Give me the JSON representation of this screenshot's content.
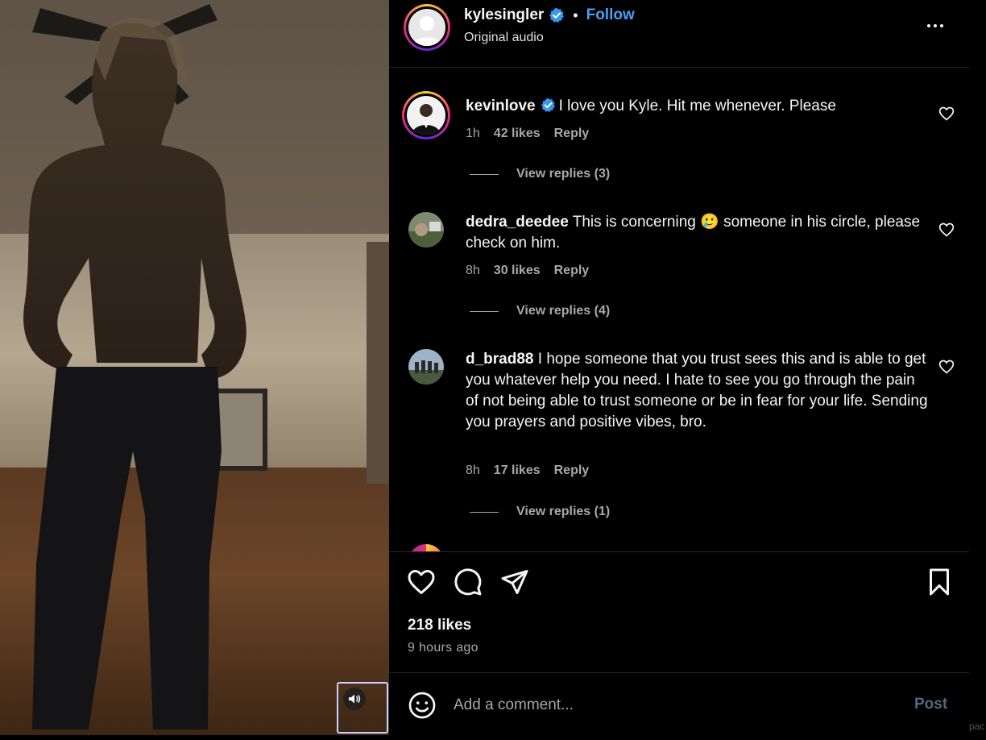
{
  "post": {
    "username": "kylesingler",
    "separator": "•",
    "follow_label": "Follow",
    "subtitle": "Original audio",
    "more_icon": "more-horizontal-icon"
  },
  "comments": [
    {
      "username": "kevinlove",
      "verified": true,
      "text": "I love you Kyle. Hit me whenever. Please",
      "time": "1h",
      "likes": "42 likes",
      "reply_label": "Reply",
      "view_replies": "View replies (3)"
    },
    {
      "username": "dedra_deedee",
      "verified": false,
      "text": "This is concerning 🥲 someone in his circle, please check on him.",
      "time": "8h",
      "likes": "30 likes",
      "reply_label": "Reply",
      "view_replies": "View replies (4)"
    },
    {
      "username": "d_brad88",
      "verified": false,
      "text": "I hope someone that you trust sees this and is able to get you whatever help you need. I hate to see you go through the pain of not being able to trust someone or be in fear for your life. Sending you prayers and positive vibes, bro.",
      "time": "8h",
      "likes": "17 likes",
      "reply_label": "Reply",
      "view_replies": "View replies (1)"
    }
  ],
  "stats": {
    "likes": "218 likes",
    "posted": "9 hours ago"
  },
  "composer": {
    "placeholder": "Add a comment...",
    "post_label": "Post"
  },
  "edge_text": "pac",
  "colors": {
    "background": "#000000",
    "accent_blue": "#4a9ff5",
    "muted_text": "#a8a8a8",
    "post_disabled": "#4f6a80",
    "verified_badge": "#3897f0"
  }
}
